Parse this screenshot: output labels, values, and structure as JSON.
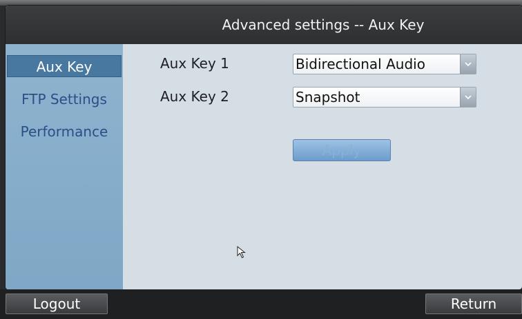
{
  "window": {
    "title": "Advanced settings -- Aux Key"
  },
  "sidebar": {
    "items": [
      {
        "label": "Aux Key",
        "active": true
      },
      {
        "label": "FTP Settings",
        "active": false
      },
      {
        "label": "Performance",
        "active": false
      }
    ]
  },
  "form": {
    "aux_key_1": {
      "label": "Aux Key 1",
      "value": "Bidirectional Audio"
    },
    "aux_key_2": {
      "label": "Aux Key 2",
      "value": "Snapshot"
    },
    "apply_label": "Apply"
  },
  "footer": {
    "logout_label": "Logout",
    "return_label": "Return"
  },
  "icons": {
    "dropdown": "chevron-down-icon",
    "cursor": "mouse-pointer-icon"
  }
}
